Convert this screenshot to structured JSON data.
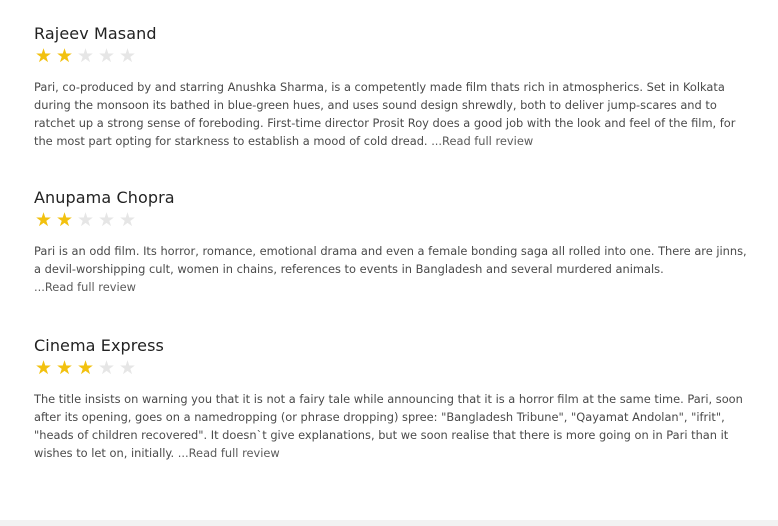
{
  "reviews": [
    {
      "critic": "Rajeev Masand",
      "rating": 2,
      "max_rating": 5,
      "text": "Pari, co-produced by and starring Anushka Sharma, is a competently made film thats rich in atmospherics. Set in Kolkata during the monsoon its bathed in blue-green hues, and uses sound design shrewdly, both to deliver jump-scares and to ratchet up a strong sense of foreboding. First-time director Prosit Roy does a good job with the look and feel of the film, for the most part opting for starkness to establish a mood of cold dread. ",
      "link": "...Read full review"
    },
    {
      "critic": "Anupama Chopra",
      "rating": 2,
      "max_rating": 5,
      "text": "Pari is an odd film. Its horror, romance, emotional drama and even a female bonding saga all rolled into one. There are jinns, a devil-worshipping cult, women in chains, references to events in Bangladesh and several murdered animals.",
      "link": "...Read full review"
    },
    {
      "critic": "Cinema Express",
      "rating": 3,
      "max_rating": 5,
      "text": "The title insists on warning you that it is not a fairy tale while announcing that it is a horror film at the same time. Pari, soon after its opening, goes on a namedropping (or phrase dropping) spree: \"Bangladesh Tribune\", \"Qayamat Andolan\", \"ifrit\", \"heads of children recovered\". It doesn`t give explanations, but we soon realise that there is more going on in Pari than it wishes to let on, initially. ",
      "link": "...Read full review"
    }
  ],
  "colors": {
    "star_on": "#f2c10f",
    "star_off": "#e6e6e6"
  },
  "icons": {
    "star": "star-icon"
  }
}
